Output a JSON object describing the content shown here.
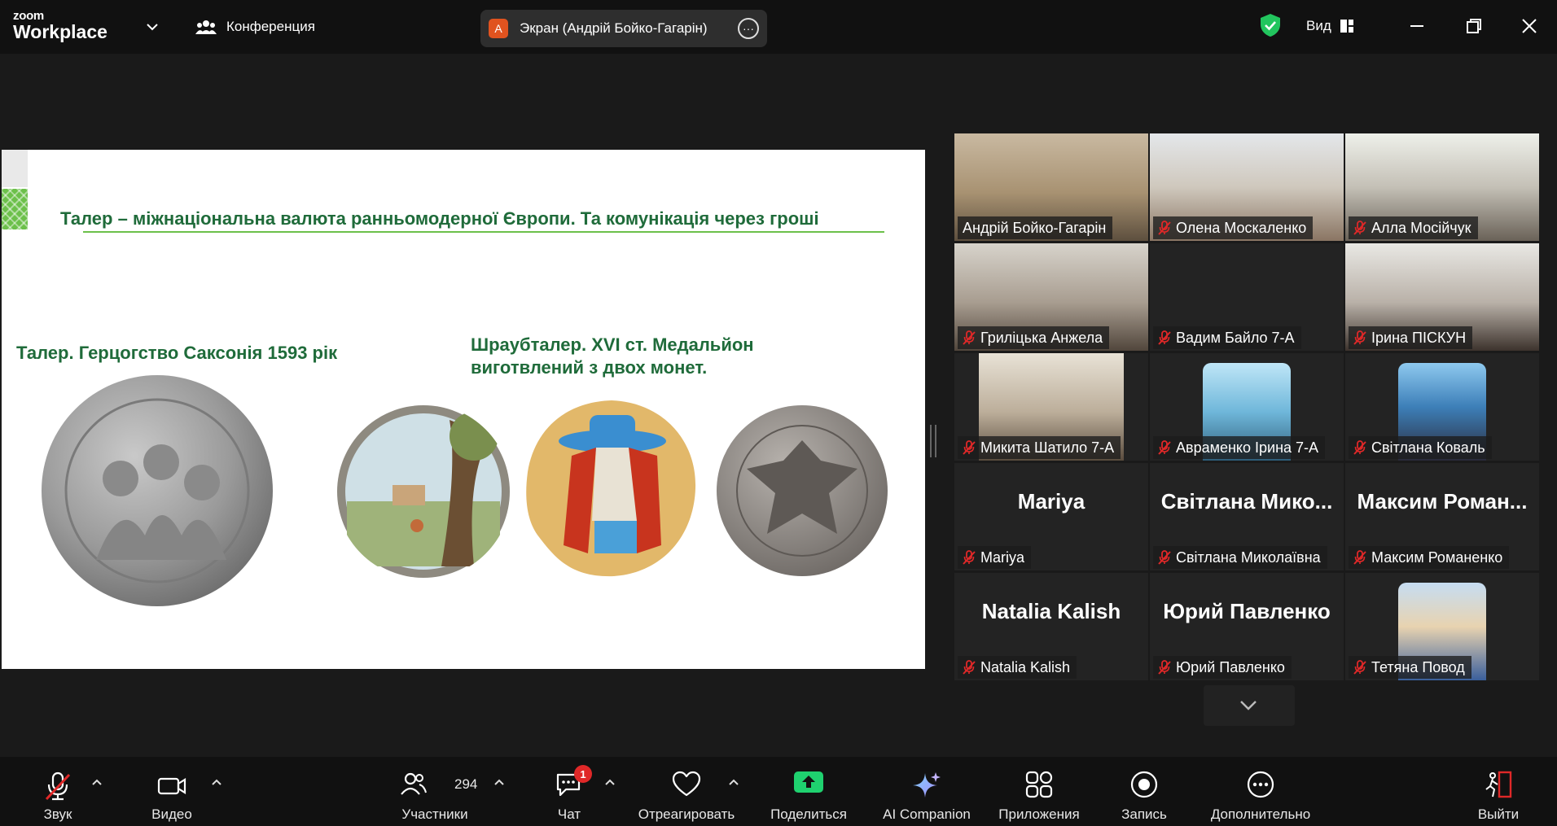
{
  "app": {
    "brand_top": "zoom",
    "brand_bottom": "Workplace",
    "meeting_label": "Конференция",
    "share_initial": "А",
    "share_label": "Экран (Андрій Бойко-Гагарін)",
    "view_label": "Вид"
  },
  "slide": {
    "title": "Талер – міжнаціональна валюта ранньомодерної Європи. Та комунікація через гроші",
    "caption_left": "Талер. Герцогство Саксонія 1593 рік",
    "caption_right_1": "Шраубталер. XVI ст. Медальйон",
    "caption_right_2": "виготвлений з двох монет."
  },
  "participants": [
    {
      "name": "Андрій Бойко-Гагарін",
      "muted": false,
      "kind": "video"
    },
    {
      "name": "Олена Москаленко",
      "muted": true,
      "kind": "video"
    },
    {
      "name": "Алла Мосійчук",
      "muted": true,
      "kind": "video"
    },
    {
      "name": "Гриліцька Анжела",
      "muted": true,
      "kind": "video"
    },
    {
      "name": "Вадим Байло 7-А",
      "muted": true,
      "kind": "blank"
    },
    {
      "name": "Ірина ПІСКУН",
      "muted": true,
      "kind": "video"
    },
    {
      "name": "Микита Шатило 7-А",
      "muted": true,
      "kind": "video"
    },
    {
      "name": "Авраменко Ірина 7-А",
      "muted": true,
      "kind": "avatar"
    },
    {
      "name": "Світлана Коваль",
      "muted": true,
      "kind": "avatar"
    },
    {
      "name": "Mariya",
      "big_name": "Mariya",
      "muted": true,
      "kind": "name"
    },
    {
      "name": "Світлана Миколаївна",
      "big_name": "Світлана Мико...",
      "muted": true,
      "kind": "name"
    },
    {
      "name": "Максим Романенко",
      "big_name": "Максим Роман...",
      "muted": true,
      "kind": "name"
    },
    {
      "name": "Natalia Kalish",
      "big_name": "Natalia Kalish",
      "muted": true,
      "kind": "name"
    },
    {
      "name": "Юрий Павленко",
      "big_name": "Юрий Павленко",
      "muted": true,
      "kind": "name"
    },
    {
      "name": "Тетяна Повод",
      "muted": true,
      "kind": "avatar"
    }
  ],
  "toolbar": {
    "audio": "Звук",
    "video": "Видео",
    "participants": "Участники",
    "participants_count": "294",
    "chat": "Чат",
    "chat_badge": "1",
    "react": "Отреагировать",
    "share": "Поделиться",
    "ai": "AI Companion",
    "apps": "Приложения",
    "record": "Запись",
    "more": "Дополнительно",
    "leave": "Выйти"
  },
  "colors": {
    "accent_green": "#2ad67a",
    "share_green": "#1fd16f",
    "slide_title": "#1f6b3a",
    "mute_red": "#e02828"
  }
}
